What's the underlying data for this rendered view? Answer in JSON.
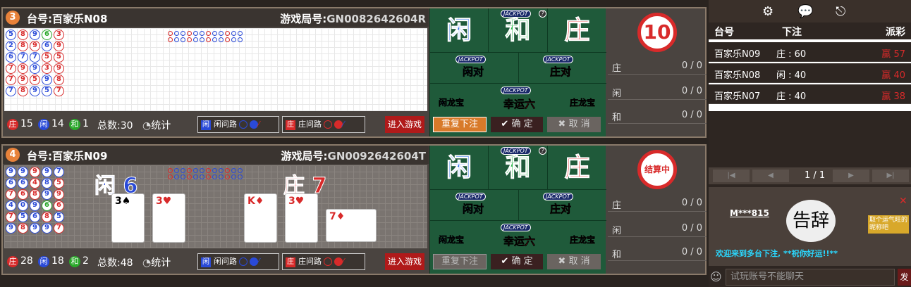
{
  "colors": {
    "banker": "#d82a2a",
    "player": "#2a4ad8",
    "tie": "#2aa82a",
    "felt": "#1f5a3a",
    "accent": "#d87a2a"
  },
  "tables": [
    {
      "number": "3",
      "name": "台号:百家乐N08",
      "game_id_label": "游戏局号:",
      "game_id": "GN0082642604R",
      "bead_road": [
        [
          {
            "c": "b",
            "n": "5"
          },
          {
            "c": "b",
            "n": "2"
          },
          {
            "c": "b",
            "n": "6"
          },
          {
            "c": "r",
            "n": "7"
          },
          {
            "c": "r",
            "n": "7"
          },
          {
            "c": "b",
            "n": "7"
          }
        ],
        [
          {
            "c": "r",
            "n": "8"
          },
          {
            "c": "r",
            "n": "8"
          },
          {
            "c": "b",
            "n": "7"
          },
          {
            "c": "r",
            "n": "9"
          },
          {
            "c": "r",
            "n": "9"
          },
          {
            "c": "r",
            "n": "8"
          }
        ],
        [
          {
            "c": "b",
            "n": "9"
          },
          {
            "c": "r",
            "n": "9"
          },
          {
            "c": "b",
            "n": "7"
          },
          {
            "c": "b",
            "n": "9"
          },
          {
            "c": "r",
            "n": "5"
          },
          {
            "c": "b",
            "n": "9"
          }
        ],
        [
          {
            "c": "g",
            "n": "6"
          },
          {
            "c": "b",
            "n": "6"
          },
          {
            "c": "r",
            "n": "5"
          },
          {
            "c": "r",
            "n": "3"
          },
          {
            "c": "b",
            "n": "9"
          },
          {
            "c": "b",
            "n": "5"
          }
        ],
        [
          {
            "c": "r",
            "n": "3"
          },
          {
            "c": "r",
            "n": "9"
          },
          {
            "c": "r",
            "n": "5"
          },
          {
            "c": "r",
            "n": "9"
          },
          {
            "c": "r",
            "n": "8"
          },
          {
            "c": "r",
            "n": "7"
          }
        ]
      ],
      "stats": {
        "banker": "15",
        "player": "14",
        "tie": "1",
        "total_label": "总数:",
        "total": "30",
        "stats_link": "统计"
      },
      "banker_label": "庄",
      "player_label": "闲",
      "tie_label": "和",
      "ask_player": "闲问路",
      "ask_banker": "庄问路",
      "enter": "进入游戏",
      "timer": "10",
      "bets": [
        {
          "k": "庄",
          "v": "0 / 0"
        },
        {
          "k": "闲",
          "v": "0 / 0"
        },
        {
          "k": "和",
          "v": "0 / 0"
        }
      ],
      "repeat_disabled": false
    },
    {
      "number": "4",
      "name": "台号:百家乐N09",
      "game_id_label": "游戏局号:",
      "game_id": "GN0092642604T",
      "bead_road": [
        [
          {
            "c": "b",
            "n": "9"
          },
          {
            "c": "b",
            "n": "6"
          },
          {
            "c": "r",
            "n": "7"
          },
          {
            "c": "b",
            "n": "4"
          },
          {
            "c": "r",
            "n": "7"
          },
          {
            "c": "b",
            "n": "9"
          }
        ],
        [
          {
            "c": "b",
            "n": "9"
          },
          {
            "c": "b",
            "n": "6"
          },
          {
            "c": "r",
            "n": "6"
          },
          {
            "c": "b",
            "n": "0"
          },
          {
            "c": "b",
            "n": "5"
          },
          {
            "c": "r",
            "n": "8"
          }
        ],
        [
          {
            "c": "r",
            "n": "9"
          },
          {
            "c": "r",
            "n": "4"
          },
          {
            "c": "r",
            "n": "8"
          },
          {
            "c": "b",
            "n": "9"
          },
          {
            "c": "b",
            "n": "6"
          },
          {
            "c": "b",
            "n": "9"
          }
        ],
        [
          {
            "c": "b",
            "n": "9"
          },
          {
            "c": "b",
            "n": "8"
          },
          {
            "c": "b",
            "n": "9"
          },
          {
            "c": "g",
            "n": "6"
          },
          {
            "c": "r",
            "n": "8"
          },
          {
            "c": "b",
            "n": "9"
          }
        ],
        [
          {
            "c": "b",
            "n": "7"
          },
          {
            "c": "r",
            "n": "5"
          },
          {
            "c": "r",
            "n": "9"
          },
          {
            "c": "r",
            "n": "6"
          },
          {
            "c": "b",
            "n": "5"
          },
          {
            "c": "r",
            "n": "7"
          }
        ]
      ],
      "result": {
        "player_label": "闲",
        "player_score": "6",
        "banker_label": "庄",
        "banker_score": "7"
      },
      "player_cards": [
        "3♠",
        "3♥"
      ],
      "banker_cards": [
        "K♦",
        "3♥",
        "7♦"
      ],
      "stats": {
        "banker": "28",
        "player": "18",
        "tie": "2",
        "total_label": "总数:",
        "total": "48",
        "stats_link": "统计"
      },
      "banker_label": "庄",
      "player_label": "闲",
      "tie_label": "和",
      "ask_player": "闲问路",
      "ask_banker": "庄问路",
      "enter": "进入游戏",
      "timer": "结算中",
      "bets": [
        {
          "k": "庄",
          "v": "0 / 0"
        },
        {
          "k": "闲",
          "v": "0 / 0"
        },
        {
          "k": "和",
          "v": "0 / 0"
        }
      ],
      "repeat_disabled": true
    }
  ],
  "betboard": {
    "player": "闲",
    "tie": "和",
    "banker": "庄",
    "jackpot": "JACKPOT",
    "help": "?",
    "player_pair": "闲对",
    "banker_pair": "庄对",
    "player_dragon": "闲龙宝",
    "lucky_six": "幸运六",
    "banker_dragon": "庄龙宝",
    "repeat": "重复下注",
    "confirm": "确 定",
    "cancel": "取 消"
  },
  "right_panel": {
    "icons": [
      "gear-icon",
      "chat-icon",
      "exit-icon"
    ],
    "headers": {
      "table": "台号",
      "bet": "下注",
      "payout": "派彩"
    },
    "records": [
      {
        "table": "百家乐N09",
        "bet": "庄 : 60",
        "payout_label": "赢",
        "payout": "57"
      },
      {
        "table": "百家乐N08",
        "bet": "闲 : 40",
        "payout_label": "赢",
        "payout": "40"
      },
      {
        "table": "百家乐N07",
        "bet": "庄 : 40",
        "payout_label": "赢",
        "payout": "38"
      }
    ],
    "page": "1 / 1",
    "chat_user": "M***815",
    "sticker_text": "告辞",
    "tip": "取个运气旺的昵称吧",
    "welcome": "欢迎来到多台下注, **祝你好运!!**",
    "chat_placeholder": "试玩账号不能聊天",
    "send": "发"
  }
}
